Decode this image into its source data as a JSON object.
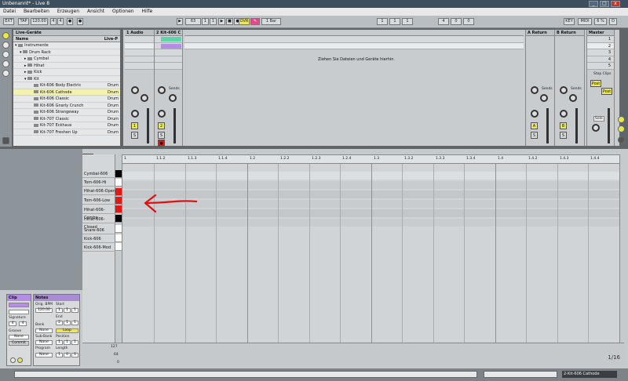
{
  "window": {
    "title": "Unbenannt* - Live 8",
    "min": "_",
    "max": "□",
    "close": "x"
  },
  "menu": [
    "Datei",
    "Bearbeiten",
    "Erzeugen",
    "Ansicht",
    "Optionen",
    "Hilfe"
  ],
  "transport": {
    "ext": "EXT",
    "tap": "TAP",
    "tempo": "120.00",
    "sig_num": "4",
    "sig_den": "4",
    "bar_pos": "63",
    "beat": "1",
    "sub": "1",
    "ovr": "OVR",
    "quant": "1 Bar",
    "pos2": "1",
    "pos3": "1",
    "pos4": "1",
    "len1": "4",
    "len2": "0",
    "len3": "0",
    "key": "KEY",
    "midi": "MIDI",
    "cpu": "6 %",
    "d": "D"
  },
  "browser": {
    "title": "Live-Geräte",
    "col_name": "Name",
    "col_type": "Live-P",
    "items": [
      {
        "label": "Instrumente",
        "tag": ""
      },
      {
        "label": "Drum Rack",
        "tag": ""
      },
      {
        "label": "Cymbal",
        "tag": ""
      },
      {
        "label": "Hihat",
        "tag": ""
      },
      {
        "label": "Kick",
        "tag": ""
      },
      {
        "label": "Kit",
        "tag": ""
      },
      {
        "label": "Kit-606 Body Electric",
        "tag": "Drum"
      },
      {
        "label": "Kit-606 Cathode",
        "tag": "Drum"
      },
      {
        "label": "Kit-606 Classic",
        "tag": "Drum"
      },
      {
        "label": "Kit-606 Gnarly Crunch",
        "tag": "Drum"
      },
      {
        "label": "Kit-606 Strangeway",
        "tag": "Drum"
      },
      {
        "label": "Kit-707 Classic",
        "tag": "Drum"
      },
      {
        "label": "Kit-707 Eckhaus",
        "tag": "Drum"
      },
      {
        "label": "Kit-707 Freshen Up",
        "tag": "Drum"
      }
    ]
  },
  "session": {
    "tracks": [
      {
        "name": "1 Audio",
        "num": "1",
        "solo": "S"
      },
      {
        "name": "2 Kit-606 C",
        "num": "2",
        "solo": "S"
      }
    ],
    "drop_hint": "Ziehen Sie Dateien und Geräte hierhin.",
    "returns": [
      {
        "name": "A Return",
        "num": "A",
        "solo": "S"
      },
      {
        "name": "B Return",
        "num": "B",
        "solo": "S"
      }
    ],
    "master": {
      "name": "Master",
      "scenes": [
        "1",
        "2",
        "3",
        "4",
        "5"
      ],
      "stop": "Stop Clips",
      "post": "Post",
      "solo": "Solo"
    },
    "sends": "Sends",
    "post": "Post"
  },
  "editor": {
    "fold": "Fold",
    "drums": [
      "Cymbal-606",
      "Tom-606-Hi",
      "Hihat-606-Open",
      "Tom-606-Low",
      "Hihat-606-Combo",
      "Hihat-606-Closed",
      "Snare-606",
      "Kick-606",
      "Kick-606-Mod"
    ],
    "ruler": [
      "1",
      "1.1.2",
      "1.1.3",
      "1.1.4",
      "1.2",
      "1.2.2",
      "1.2.3",
      "1.2.4",
      "1.3",
      "1.3.2",
      "1.3.3",
      "1.3.4",
      "1.4",
      "1.4.2",
      "1.4.3",
      "1.4.4"
    ],
    "vel_max": "127",
    "vel_mid": "64",
    "vel_min": "0",
    "page": "1/16"
  },
  "clip": {
    "title": "Clip",
    "sig_label": "Signature",
    "sig_num": "4",
    "sig_den": "4",
    "groove_label": "Groove",
    "groove": "None",
    "commit": "Commit"
  },
  "notes": {
    "title": "Notes",
    "orig_bpm_label": "Orig. BPM",
    "orig_bpm": "120.00",
    "start_label": "Start",
    "start": [
      "1",
      "1",
      "1"
    ],
    "end_label": "End",
    "end": [
      "2",
      "1",
      "1"
    ],
    "bank_label": "Bank",
    "bank": "None",
    "loop": "Loop",
    "subbank_label": "Sub-Bank",
    "subbank": "None",
    "position_label": "Position",
    "position": [
      "1",
      "1",
      "1"
    ],
    "program_label": "Program",
    "program": "None",
    "length_label": "Length",
    "length": [
      "1",
      "0",
      "0"
    ]
  },
  "status": {
    "device": "2-Kit-606 Cathode"
  },
  "colors": {
    "accent": "#ece65c",
    "clip_green": "#5fd4a8",
    "clip_purple": "#b58ce6",
    "pad_red": "#e01818",
    "arrow_red": "#e01010"
  }
}
